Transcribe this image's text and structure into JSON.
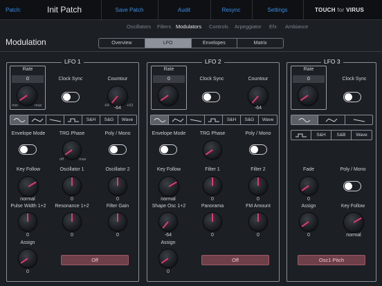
{
  "topbar": {
    "patch_label": "Patch:",
    "patch_name": "Init Patch",
    "save_patch": "Save Patch",
    "audit": "Audit",
    "resync": "Resync",
    "settings": "Settings",
    "brand_touch": "TOUCH",
    "brand_for": "for",
    "brand_virus": "VIRUS"
  },
  "subnav": [
    "Oscillators",
    "Filters",
    "Modulators",
    "Controls",
    "Arpeggiator",
    "Efx",
    "Ambiance"
  ],
  "subnav_active": "Modulators",
  "page_title": "Modulation",
  "tabs": [
    "Overview",
    "LFO",
    "Envelopes",
    "Matrix"
  ],
  "active_tab": "LFO",
  "wave_labels": {
    "sh": "S&H",
    "sg": "S&G",
    "wave": "Wave",
    "sb": "S&B"
  },
  "lfo1": {
    "title": "LFO 1",
    "rate_label": "Rate",
    "rate_value": "0",
    "rate_min": "min",
    "rate_max": "max",
    "clock_sync": "Clock Sync",
    "contour": "Countour",
    "contour_value": "-64",
    "contour_min": "-64",
    "contour_max": "+63",
    "env_mode": "Envelope Mode",
    "trg_phase": "TRG Phase",
    "trg_min": "off",
    "trg_max": "max",
    "poly_mono": "Poly / Mono",
    "key_follow": "Key Follow",
    "key_follow_value": "normal",
    "osc1": "Oscillator 1",
    "osc1_value": "0",
    "osc2": "Oscillator 2",
    "osc2_value": "0",
    "pw": "Pulse Width 1+2",
    "pw_value": "0",
    "reso": "Resonance 1+2",
    "reso_value": "0",
    "filter_gain": "Filter Gain",
    "filter_gain_value": "0",
    "assign": "Assign",
    "assign_value": "0",
    "assign_target": "Off"
  },
  "lfo2": {
    "title": "LFO 2",
    "rate_label": "Rate",
    "rate_value": "0",
    "clock_sync": "Clock Sync",
    "contour": "Countour",
    "contour_value": "-64",
    "env_mode": "Envelope Mode",
    "trg_phase": "TRG Phase",
    "poly_mono": "Poly / Mono",
    "key_follow": "Key Follow",
    "key_follow_value": "normal",
    "filter1": "Filter 1",
    "filter1_value": "0",
    "filter2": "Filter 2",
    "filter2_value": "0",
    "shape": "Shape Osc 1+2",
    "shape_value": "-64",
    "panorama": "Panorama",
    "panorama_value": "0",
    "fm": "FM Amount",
    "fm_value": "0",
    "assign": "Assign",
    "assign_value": "0",
    "assign_target": "Off"
  },
  "lfo3": {
    "title": "LFO 3",
    "rate_label": "Rate",
    "rate_value": "0",
    "clock_sync": "Clock Sync",
    "fade": "Fade",
    "fade_value": "0",
    "poly_mono": "Poly / Mono",
    "assign": "Assign",
    "assign_value": "0",
    "key_follow": "Key Follow",
    "key_follow_value": "normal",
    "assign_target": "Osc1 Pitch"
  },
  "colors": {
    "accent": "#3b8fe8",
    "knob_indicator": "#e8386d",
    "assign_button": "#6e3f48"
  }
}
